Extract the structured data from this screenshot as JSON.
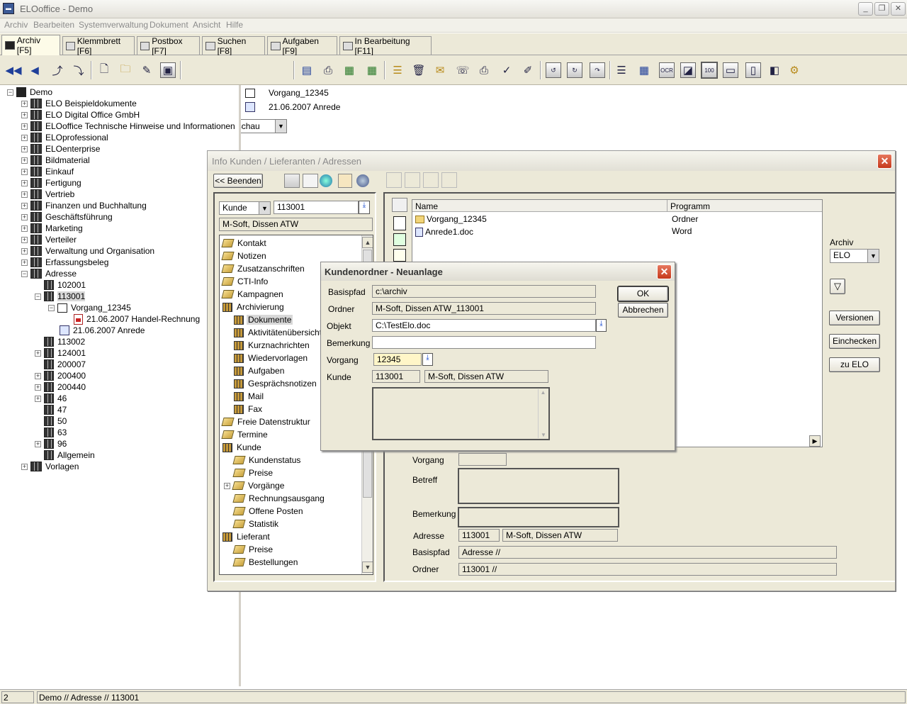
{
  "window": {
    "title": "ELOoffice  -  Demo",
    "app_icon": "elo-app-icon"
  },
  "menu": [
    "Archiv",
    "Bearbeiten",
    "Systemverwaltung",
    "Dokument",
    "Ansicht",
    "Hilfe"
  ],
  "tabs": [
    {
      "label": "Archiv [F5]",
      "active": true
    },
    {
      "label": "Klemmbrett [F6]"
    },
    {
      "label": "Postbox [F7]"
    },
    {
      "label": "Suchen [F8]"
    },
    {
      "label": "Aufgaben [F9]"
    },
    {
      "label": "In Bearbeitung [F11]"
    }
  ],
  "toolbar": {
    "view_select": "Nach Vorausschau"
  },
  "tree": {
    "root": "Demo",
    "items": [
      {
        "label": "ELO Beispieldokumente"
      },
      {
        "label": "ELO Digital Office GmbH"
      },
      {
        "label": "ELOoffice Technische Hinweise und Informationen"
      },
      {
        "label": "ELOprofessional"
      },
      {
        "label": "ELOenterprise"
      },
      {
        "label": "Bildmaterial"
      },
      {
        "label": "Einkauf"
      },
      {
        "label": "Fertigung"
      },
      {
        "label": "Vertrieb"
      },
      {
        "label": "Finanzen und Buchhaltung"
      },
      {
        "label": "Geschäftsführung"
      },
      {
        "label": "Marketing"
      },
      {
        "label": "Verteiler"
      },
      {
        "label": "Verwaltung und Organisation"
      },
      {
        "label": "Erfassungsbeleg"
      },
      {
        "label": "Adresse"
      }
    ],
    "adresse_children": [
      "102001",
      "113001",
      "113002",
      "124001",
      "200007",
      "200400",
      "200440",
      "46",
      "47",
      "50",
      "63",
      "96",
      "Allgemein"
    ],
    "vorgang": "Vorgang_12345",
    "docs": [
      "21.06.2007  Handel-Rechnung",
      "21.06.2007  Anrede"
    ],
    "last": "Vorlagen"
  },
  "right_list": [
    {
      "label": "Vorgang_12345"
    },
    {
      "label": "21.06.2007  Anrede"
    }
  ],
  "info_dialog": {
    "title": "Info Kunden / Lieferanten / Adressen",
    "beenden": "<< Beenden",
    "kunde_type": "Kunde",
    "kunde_nr": "113001",
    "kunde_name": "M-Soft, Dissen ATW",
    "categories": [
      {
        "label": "Kontakt",
        "lvl": 0,
        "ic": "book"
      },
      {
        "label": "Notizen",
        "lvl": 0,
        "ic": "book"
      },
      {
        "label": "Zusatzanschriften",
        "lvl": 0,
        "ic": "book"
      },
      {
        "label": "CTI-Info",
        "lvl": 0,
        "ic": "book"
      },
      {
        "label": "Kampagnen",
        "lvl": 0,
        "ic": "book"
      },
      {
        "label": "Archivierung",
        "lvl": 0,
        "ic": "shelf"
      },
      {
        "label": "Dokumente",
        "lvl": 1,
        "ic": "shelf",
        "sel": true
      },
      {
        "label": "Aktivitätenübersicht",
        "lvl": 1,
        "ic": "shelf"
      },
      {
        "label": "Kurznachrichten",
        "lvl": 1,
        "ic": "shelf"
      },
      {
        "label": "Wiedervorlagen",
        "lvl": 1,
        "ic": "shelf"
      },
      {
        "label": "Aufgaben",
        "lvl": 1,
        "ic": "shelf"
      },
      {
        "label": "Gesprächsnotizen",
        "lvl": 1,
        "ic": "shelf"
      },
      {
        "label": "Mail",
        "lvl": 1,
        "ic": "shelf"
      },
      {
        "label": "Fax",
        "lvl": 1,
        "ic": "shelf"
      },
      {
        "label": "Freie Datenstruktur",
        "lvl": 0,
        "ic": "book"
      },
      {
        "label": "Termine",
        "lvl": 0,
        "ic": "book"
      },
      {
        "label": "Kunde",
        "lvl": 0,
        "ic": "shelf"
      },
      {
        "label": "Kundenstatus",
        "lvl": 1,
        "ic": "book"
      },
      {
        "label": "Preise",
        "lvl": 1,
        "ic": "book"
      },
      {
        "label": "Vorgänge",
        "lvl": 1,
        "ic": "book",
        "exp": true
      },
      {
        "label": "Rechnungsausgang",
        "lvl": 1,
        "ic": "book"
      },
      {
        "label": "Offene Posten",
        "lvl": 1,
        "ic": "book"
      },
      {
        "label": "Statistik",
        "lvl": 1,
        "ic": "book"
      },
      {
        "label": "Lieferant",
        "lvl": 0,
        "ic": "shelf"
      },
      {
        "label": "Preise",
        "lvl": 1,
        "ic": "book"
      },
      {
        "label": "Bestellungen",
        "lvl": 1,
        "ic": "book"
      }
    ],
    "grid": {
      "headers": [
        "Name",
        "Programm"
      ],
      "rows": [
        {
          "name": "Vorgang_12345",
          "program": "Ordner"
        },
        {
          "name": "Anrede1.doc",
          "program": "Word"
        }
      ]
    },
    "archiv_label": "Archiv",
    "archiv_value": "ELO",
    "versionen": "Versionen",
    "einchecken": "Einchecken",
    "zu_elo": "zu ELO",
    "detail": {
      "vorgang_label": "Vorgang",
      "betreff_label": "Betreff",
      "bemerkung_label": "Bemerkung",
      "adresse_label": "Adresse",
      "adresse_nr": "113001",
      "adresse_name": "M-Soft, Dissen ATW",
      "basispfad_label": "Basispfad",
      "basispfad_value": "Adresse //",
      "ordner_label": "Ordner",
      "ordner_value": "113001 //"
    }
  },
  "kunden_dialog": {
    "title": "Kundenordner - Neuanlage",
    "ok": "OK",
    "abbrechen": "Abbrechen",
    "basispfad_label": "Basispfad",
    "basispfad": "c:\\archiv",
    "ordner_label": "Ordner",
    "ordner": "M-Soft, Dissen ATW_113001",
    "objekt_label": "Objekt",
    "objekt": "C:\\TestElo.doc",
    "bemerkung_label": "Bemerkung",
    "bemerkung": "",
    "vorgang_label": "Vorgang",
    "vorgang": "12345",
    "kunde_label": "Kunde",
    "kunde_nr": "113001",
    "kunde_name": "M-Soft, Dissen ATW"
  },
  "statusbar": {
    "count": "2",
    "path": "Demo // Adresse // 113001"
  }
}
